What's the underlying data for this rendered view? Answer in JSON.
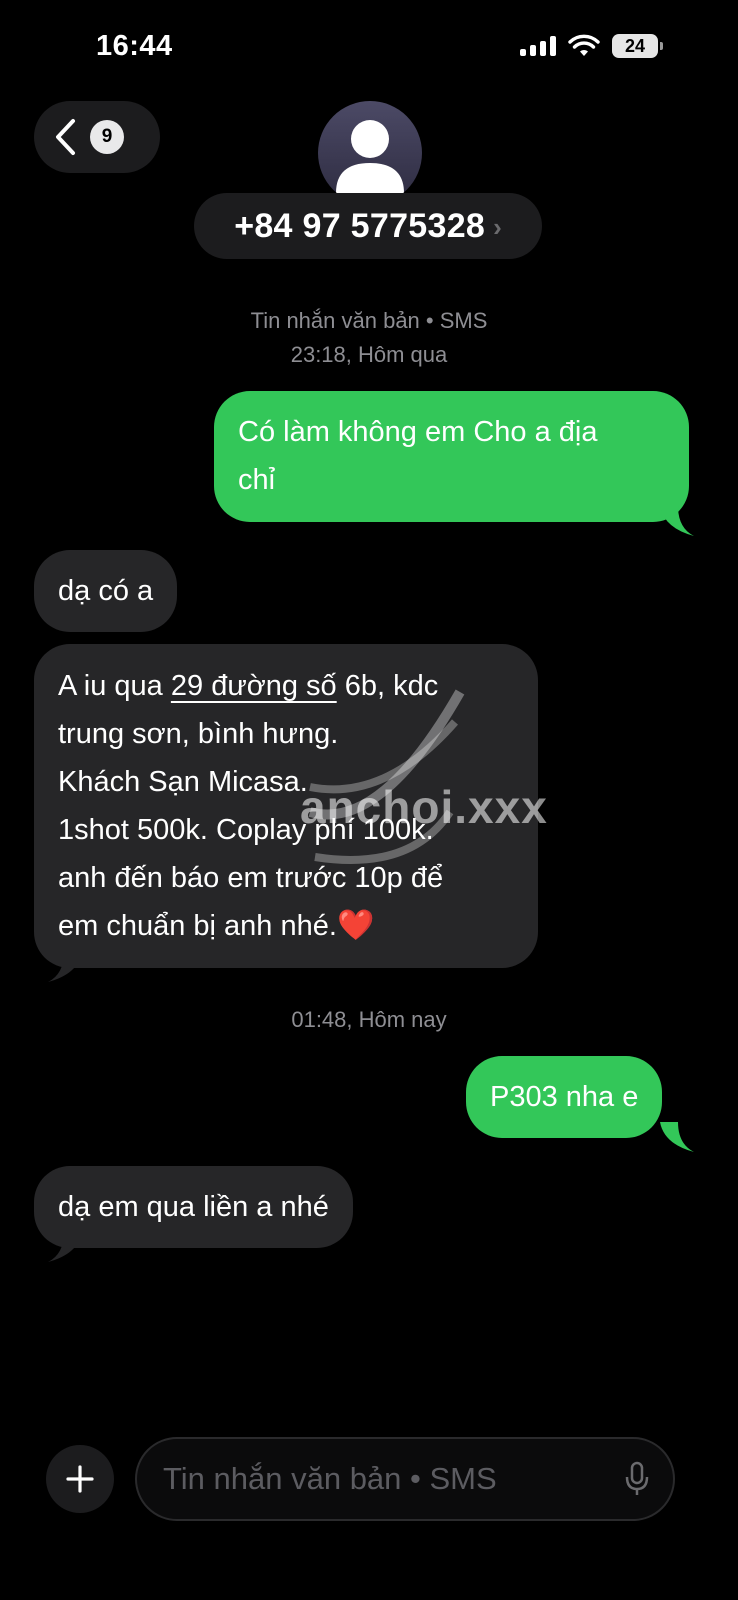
{
  "status_bar": {
    "time": "16:44",
    "battery": "24"
  },
  "header": {
    "back_badge": "9",
    "contact": "+84 97 5775328",
    "chevron": "›"
  },
  "meta": {
    "channel": "Tin nhắn văn bản • SMS",
    "date1": "23:18, Hôm qua",
    "date2": "01:48, Hôm nay"
  },
  "messages": [
    {
      "dir": "out",
      "lines": [
        "Có làm không em Cho a địa",
        "chỉ"
      ]
    },
    {
      "dir": "in",
      "lines": [
        "dạ có a"
      ]
    },
    {
      "dir": "in",
      "line1_pre": "A iu qua ",
      "line1_link": "29 đường số",
      "line1_post": " 6b, kdc",
      "line2": "trung sơn, bình hưng.",
      "line3": " Khách Sạn Micasa.",
      "line4": "1shot 500k. Coplay phí 100k.",
      "line5": "anh đến báo em trước 10p để",
      "line6": "em chuẩn bị anh nhé.",
      "emoji": "❤️"
    },
    {
      "dir": "out",
      "lines": [
        "P303 nha e"
      ]
    },
    {
      "dir": "in",
      "lines": [
        "dạ em qua liền a nhé"
      ]
    }
  ],
  "watermark": "anchoi.xxx",
  "input": {
    "placeholder": "Tin nhắn văn bản • SMS"
  },
  "colors": {
    "outgoing": "#33c759",
    "incoming": "#262628",
    "background": "#000000"
  }
}
